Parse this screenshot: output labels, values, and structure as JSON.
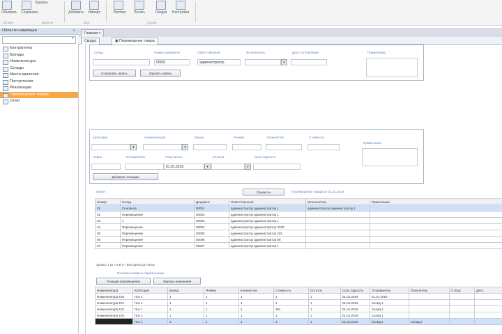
{
  "ribbon": {
    "buttons": [
      "Обновить",
      "Сохранить",
      "Удалить",
      "Добавить",
      "Импорт",
      "Экспорт",
      "Печать",
      "Сводка",
      "Настройки",
      "Справка"
    ],
    "groups": [
      "Записи",
      "Данные",
      "Вид",
      "Сервис"
    ]
  },
  "nav": {
    "header": "Области навигации",
    "search_placeholder": "",
    "items": [
      "Контрагенты",
      "Бренды",
      "Номенклатура",
      "Склады",
      "Места хранения",
      "Поступления",
      "Реализации",
      "Перемещение товара",
      "Отчёт"
    ],
    "selected_index": 7
  },
  "doc_tabs": [
    "Главная"
  ],
  "sub_tabs": [
    "Сводка",
    "Перемещение товара"
  ],
  "form1": {
    "labels": [
      "Склад",
      "Номер документа",
      "Ответственный",
      "Исполнитель",
      "Дата составления",
      "Примечание"
    ],
    "values": [
      "",
      "00001",
      "администратор",
      ""
    ],
    "buttons": [
      "Сохранить запись",
      "Удалить запись"
    ]
  },
  "form2": {
    "labels": [
      "Категория",
      "Номенклатура",
      "Бренд",
      "Ячейка",
      "Количество",
      "Стоимость",
      "Серия",
      "Отправитель",
      "Получатель",
      "Остаток",
      "Срок годности",
      "Примечание"
    ],
    "values": [
      "",
      "",
      "",
      "",
      "",
      "",
      "",
      "",
      "",
      "",
      "",
      ""
    ],
    "date_value": "01.01.2019",
    "button": "Добавить позицию"
  },
  "mid": {
    "link_left": "Копия",
    "center_button": "Провести",
    "link_right": "Перемещение товара от 01.01.2019"
  },
  "table1": {
    "columns": [
      "Номер",
      "Склад",
      "Документ",
      "Ответственный",
      "Исполнитель",
      "Примечание"
    ],
    "rows": [
      [
        "01",
        "Основной",
        "00001",
        "администратор администратор 1",
        "администратор администратор 1",
        ""
      ],
      [
        "02",
        "Перемещение",
        "00002",
        "администратор администратор 1",
        "",
        ""
      ],
      [
        "03",
        "1",
        "00003",
        "администратор администратор 1",
        "",
        ""
      ],
      [
        "04",
        "Перемещение",
        "00004",
        "администратор администратор 2023",
        "",
        ""
      ],
      [
        "05",
        "Перемещение",
        "00005",
        "администратор администратор 201",
        "",
        ""
      ],
      [
        "06",
        "Перемещение",
        "00006",
        "администратор администратор 88",
        "",
        ""
      ],
      [
        "07",
        "Перемещение",
        "00007",
        "администратор администратор 1",
        "",
        ""
      ]
    ],
    "selected_row": 0,
    "pager": "Запись 1 из 7  ▸  ▸|  ▸+    Без фильтра   Поиск"
  },
  "mid2": {
    "link": "Позиции товара в перемещении"
  },
  "table2": {
    "tabs": [
      "Позиции перемещения",
      "Журнал изменений"
    ],
    "columns": [
      "Номенклатура",
      "Категория",
      "Бренд",
      "Ячейка",
      "Количество",
      "Стоимость",
      "Остаток",
      "Срок годности",
      "Отправитель",
      "Получатель",
      "Статус",
      "Дата"
    ],
    "rows": [
      [
        "Номенклатура 100",
        "Поз 1",
        "1",
        "1",
        "1",
        "1",
        "1",
        "01.01.2019",
        "01.01.2019",
        "",
        "",
        ""
      ],
      [
        "Номенклатура 101",
        "Поз 1",
        "1",
        "1",
        "1",
        "1",
        "1",
        "01.01.2019",
        "Склад 1",
        "",
        "",
        ""
      ],
      [
        "Номенклатура 102",
        "Поз 1",
        "1",
        "1",
        "1",
        "101",
        "1",
        "01.01.2019",
        "Склад 1",
        "",
        "",
        ""
      ],
      [
        "Номенклатура 103",
        "Поз 1",
        "1",
        "1",
        "1",
        "1",
        "1",
        "01.01.2019",
        "Склад 1",
        "",
        "",
        ""
      ],
      [
        "Номенклатура 104",
        "Поз 1",
        "1",
        "1",
        "1",
        "1",
        "1",
        "01.01.2019",
        "Склад 1",
        "Склад 2",
        "",
        ""
      ]
    ],
    "selected_row": 4
  },
  "colors": {
    "accent": "#f7a745",
    "selection": "#cfe1f7",
    "link": "#5b83c9"
  }
}
